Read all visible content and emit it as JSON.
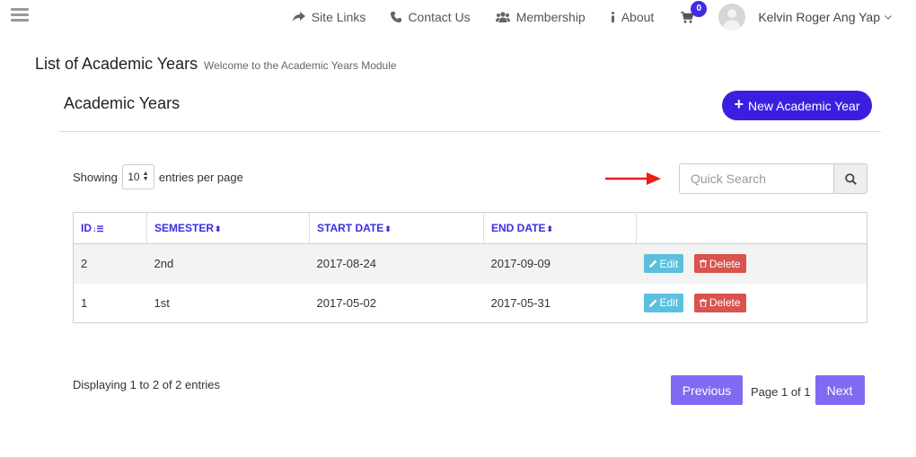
{
  "nav": {
    "site_links": "Site Links",
    "contact_us": "Contact Us",
    "membership": "Membership",
    "about": "About",
    "cart_count": "0",
    "user_name": "Kelvin Roger Ang Yap"
  },
  "page": {
    "title": "List of Academic Years",
    "subtitle": "Welcome to the Academic Years Module"
  },
  "card": {
    "title": "Academic Years",
    "new_button": "New Academic Year"
  },
  "listing": {
    "showing_label": "Showing",
    "per_page_value": "10",
    "per_page_suffix": "entries per page",
    "search_placeholder": "Quick Search"
  },
  "table": {
    "headers": [
      "ID",
      "SEMESTER",
      "START DATE",
      "END DATE"
    ],
    "rows": [
      {
        "id": "2",
        "semester": "2nd",
        "start": "2017-08-24",
        "end": "2017-09-09"
      },
      {
        "id": "1",
        "semester": "1st",
        "start": "2017-05-02",
        "end": "2017-05-31"
      }
    ],
    "edit_label": "Edit",
    "delete_label": "Delete"
  },
  "footer": {
    "displaying": "Displaying 1 to 2 of 2 entries",
    "previous": "Previous",
    "page_info": "Page 1 of 1",
    "next": "Next"
  },
  "colors": {
    "accent": "#3b1fe0",
    "pager": "#7e6bf2",
    "edit": "#5bc0de",
    "delete": "#d9534f",
    "arrow": "#e8201a"
  }
}
